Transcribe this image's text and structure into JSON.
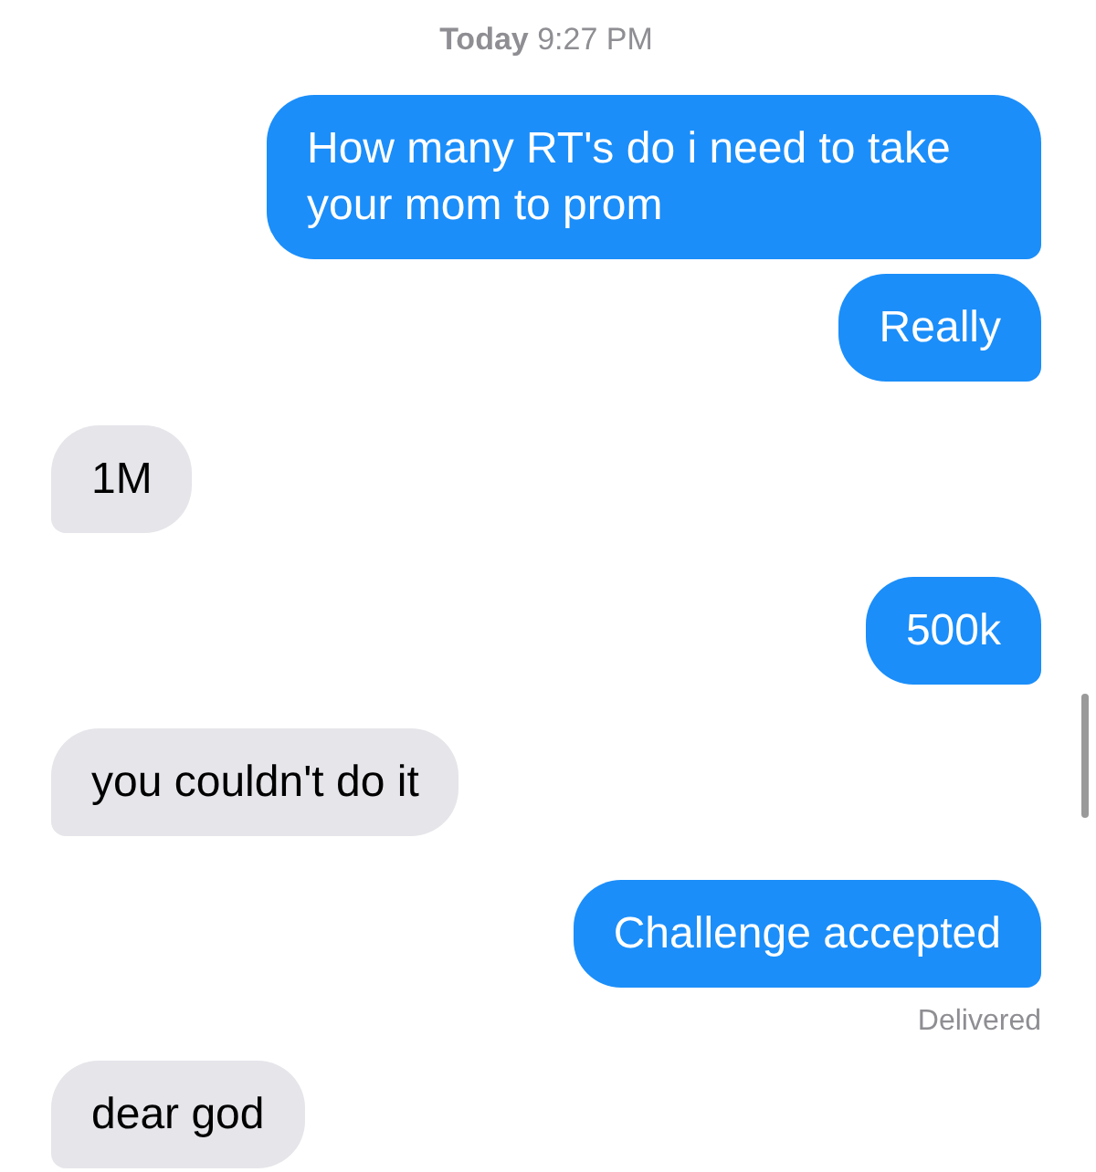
{
  "timestamp": "**Today** 9:27 PM",
  "messages": [
    {
      "kind": "sent",
      "text": "How many RT's do i need to take your mom to prom"
    },
    {
      "kind": "sent",
      "text": "Really"
    },
    {
      "kind": "received",
      "text": "1M"
    },
    {
      "kind": "sent",
      "text": "500k"
    },
    {
      "kind": "received",
      "text": "you couldn't do it"
    },
    {
      "kind": "sent",
      "text": "Challenge accepted",
      "status": "Delivered"
    },
    {
      "kind": "received",
      "text": "dear god"
    }
  ]
}
